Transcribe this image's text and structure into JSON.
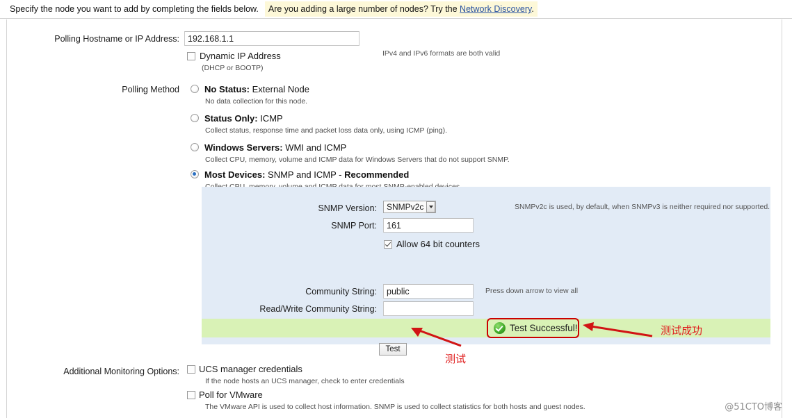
{
  "banner": {
    "intro": "Specify the node you want to add by completing the fields below.",
    "highlight_prefix": "Are you adding a large number of nodes? Try the ",
    "link_label": "Network Discovery",
    "highlight_suffix": "."
  },
  "hostname": {
    "label": "Polling Hostname or IP Address:",
    "value": "192.168.1.1",
    "placeholder": "",
    "hint": "IPv4 and IPv6 formats are both valid",
    "dynamic_ip_label": "Dynamic IP Address",
    "dynamic_ip_sub": "(DHCP or BOOTP)",
    "dynamic_ip_checked": false
  },
  "polling_method": {
    "label": "Polling Method",
    "options": [
      {
        "bold": "No Status:",
        "rest": " External Node",
        "desc": "No data collection for this node.",
        "selected": false
      },
      {
        "bold": "Status Only:",
        "rest": " ICMP",
        "desc": "Collect status, response time and packet loss data only, using ICMP (ping).",
        "selected": false
      },
      {
        "bold": "Windows Servers:",
        "rest": " WMI and ICMP",
        "desc": "Collect CPU, memory, volume and ICMP data for Windows Servers that do not support SNMP.",
        "selected": false
      },
      {
        "bold": "Most Devices:",
        "rest": " SNMP and ICMP - ",
        "rest_bold": "Recommended",
        "desc": "Collect CPU, memory, volume and ICMP data for most SNMP-enabled devices.",
        "selected": true
      }
    ]
  },
  "snmp": {
    "version_label": "SNMP Version:",
    "version_value": "SNMPv2c",
    "version_hint": "SNMPv2c is used, by default, when SNMPv3 is neither required nor supported.",
    "port_label": "SNMP Port:",
    "port_value": "161",
    "counters_label": "Allow 64 bit counters",
    "counters_checked": true,
    "community_label": "Community String:",
    "community_value": "public",
    "community_hint": "Press down arrow to view all",
    "rw_community_label": "Read/Write Community String:",
    "rw_community_value": "",
    "test_button_label": "Test",
    "test_result_label": "Test Successful!"
  },
  "additional": {
    "label": "Additional Monitoring Options:",
    "options": [
      {
        "title": "UCS manager credentials",
        "desc": "If the node hosts an UCS manager, check to enter credentials",
        "checked": false
      },
      {
        "title": "Poll for VMware",
        "desc": "The VMware API is used to collect host information. SNMP is used to collect statistics for both hosts and guest nodes.",
        "checked": false
      }
    ]
  },
  "annotations": {
    "success_note": "测试成功",
    "test_note": "测试",
    "accent_color": "#e02020"
  },
  "watermark": "@51CTO博客"
}
